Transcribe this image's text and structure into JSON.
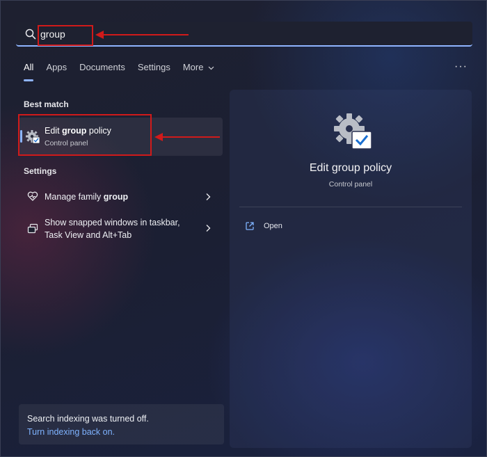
{
  "search": {
    "query": "group"
  },
  "tabs": [
    {
      "label": "All",
      "active": true
    },
    {
      "label": "Apps"
    },
    {
      "label": "Documents"
    },
    {
      "label": "Settings"
    },
    {
      "label": "More",
      "has_dropdown": true
    }
  ],
  "more_options": "···",
  "best_match": {
    "heading": "Best match",
    "title_pre": "Edit ",
    "title_bold": "group",
    "title_post": " policy",
    "subtitle": "Control panel",
    "icon": "gear-checkbox-icon"
  },
  "settings_section": {
    "heading": "Settings",
    "items": [
      {
        "label_pre": "Manage family ",
        "label_bold": "group",
        "icon": "family-heart-icon"
      },
      {
        "label_line1": "Show snapped windows in taskbar,",
        "label_line2": "Task View and Alt+Tab",
        "icon": "snap-windows-icon"
      }
    ]
  },
  "preview": {
    "title": "Edit group policy",
    "subtitle": "Control panel",
    "actions": [
      {
        "label": "Open",
        "icon": "open-external-icon"
      }
    ]
  },
  "footer": {
    "message": "Search indexing was turned off.",
    "link": "Turn indexing back on."
  },
  "colors": {
    "accent": "#8fb4ff",
    "link": "#7fb3ff",
    "annotation": "#d11a1a"
  }
}
